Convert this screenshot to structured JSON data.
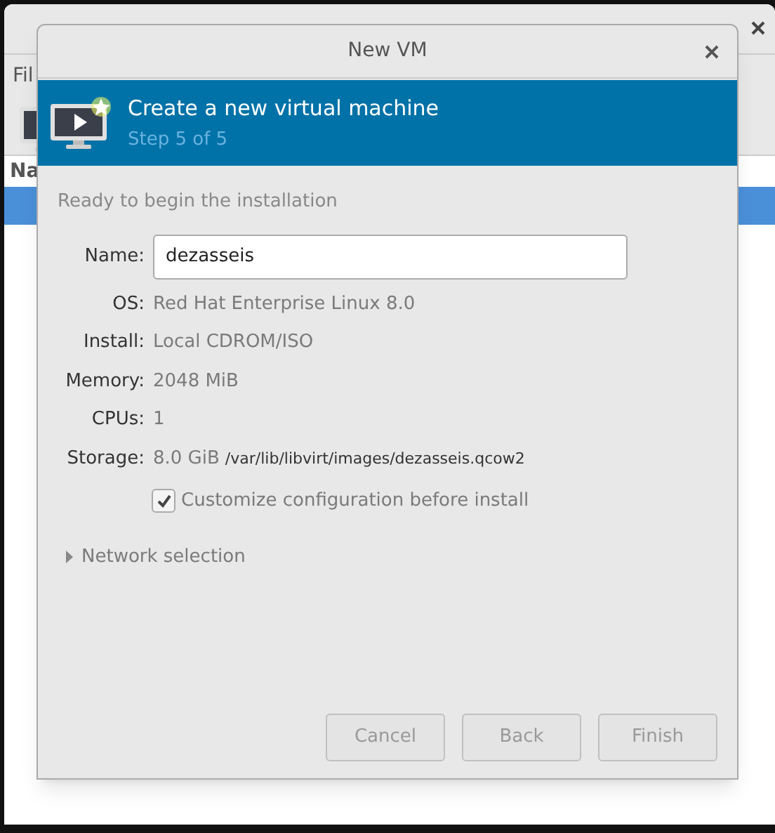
{
  "background_window": {
    "menu": [
      "Fil"
    ],
    "column_header": "Na",
    "rows": [
      {
        "selected": true
      }
    ]
  },
  "dialog": {
    "title": "New VM",
    "banner": {
      "title": "Create a new virtual machine",
      "subtitle": "Step 5 of 5"
    },
    "heading": "Ready to begin the installation",
    "name_field": {
      "label": "Name:",
      "value": "dezasseis"
    },
    "details": [
      {
        "label": "OS:",
        "value": "Red Hat Enterprise Linux 8.0"
      },
      {
        "label": "Install:",
        "value": "Local CDROM/ISO"
      },
      {
        "label": "Memory:",
        "value": "2048 MiB"
      },
      {
        "label": "CPUs:",
        "value": "1"
      },
      {
        "label": "Storage:",
        "value": "8.0 GiB",
        "extra": "/var/lib/libvirt/images/dezasseis.qcow2"
      }
    ],
    "customize": {
      "label": "Customize configuration before install",
      "checked": true
    },
    "network": {
      "label": "Network selection",
      "expanded": false
    },
    "buttons": [
      "Cancel",
      "Back",
      "Finish"
    ]
  }
}
